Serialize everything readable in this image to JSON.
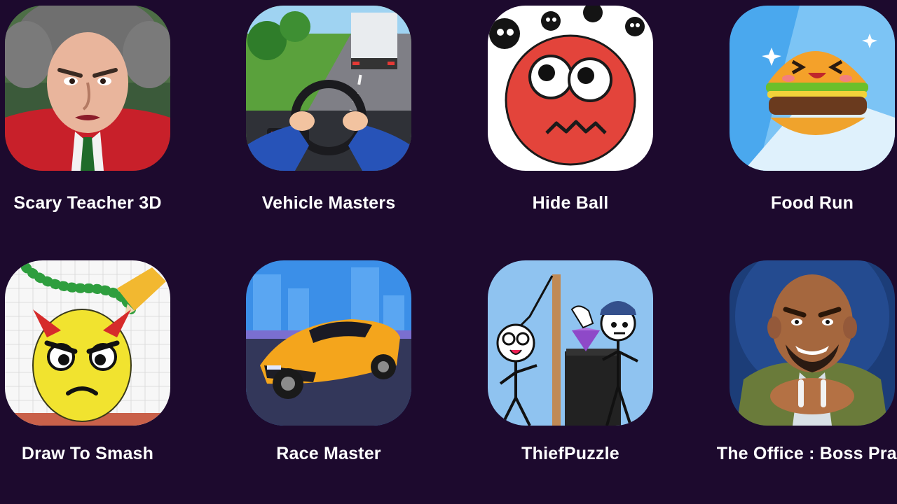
{
  "apps": [
    {
      "label": "Scary Teacher 3D",
      "icon": "scary-teacher-icon"
    },
    {
      "label": "Vehicle Masters",
      "icon": "vehicle-masters-icon"
    },
    {
      "label": "Hide Ball",
      "icon": "hide-ball-icon"
    },
    {
      "label": "Food Run",
      "icon": "food-run-icon"
    },
    {
      "label": "Draw To Smash",
      "icon": "draw-to-smash-icon"
    },
    {
      "label": "Race Master",
      "icon": "race-master-icon"
    },
    {
      "label": "ThiefPuzzle",
      "icon": "thief-puzzle-icon"
    },
    {
      "label": "The Office : Boss Pran",
      "icon": "office-boss-prank-icon"
    }
  ],
  "colors": {
    "background": "#1d0a2e",
    "label": "#ffffff"
  }
}
